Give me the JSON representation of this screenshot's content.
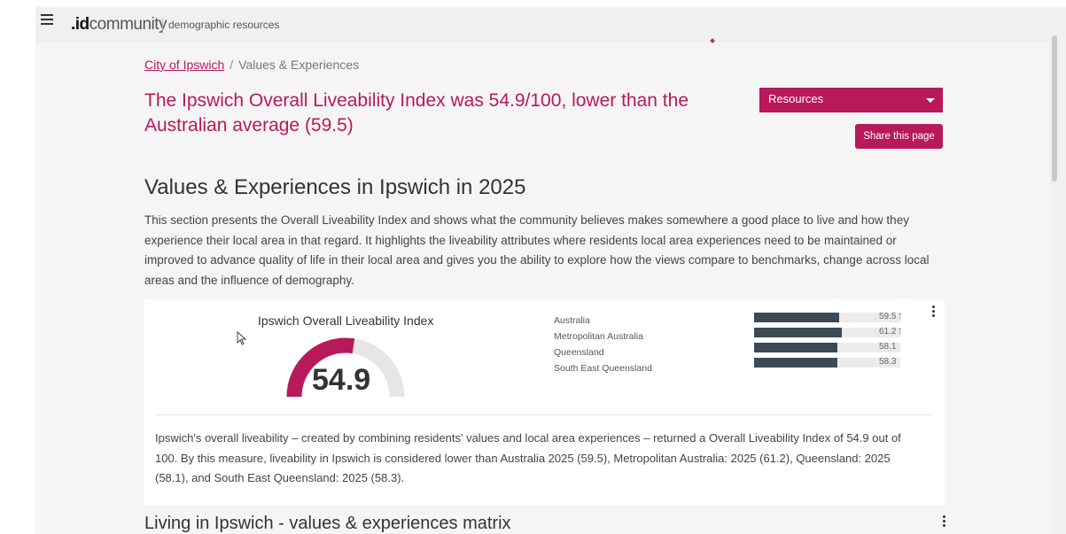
{
  "header": {
    "logo_bold": ".id",
    "logo_light": "community",
    "tagline": "demographic resources"
  },
  "breadcrumb": {
    "link": "City of Ipswich",
    "separator": "/",
    "current": "Values & Experiences"
  },
  "headline": "The Ipswich Overall Liveability Index was 54.9/100, lower than the Australian average (59.5)",
  "resources_label": "Resources",
  "share_label": "Share this page",
  "section": {
    "title": "Values & Experiences in Ipswich in 2025",
    "body": "This section presents the Overall Liveability Index and shows what the community believes makes somewhere a good place to live and how they experience their local area in that regard. It highlights the liveability attributes where residents local area experiences need to be maintained or improved to advance quality of life in their local area and gives you the ability to explore how the views compare to benchmarks, change across local areas and the influence of demography."
  },
  "index_card": {
    "gauge_title": "Ipswich Overall Liveability Index",
    "gauge_value": "54.9",
    "gauge_fraction": 0.549,
    "comparisons": [
      {
        "label": "Australia",
        "value": "59.5",
        "fraction": 0.595,
        "arrow": true
      },
      {
        "label": "Metropolitan Australia",
        "value": "61.2",
        "fraction": 0.612,
        "arrow": true
      },
      {
        "label": "Queensland",
        "value": "58.1",
        "fraction": 0.581,
        "arrow": false
      },
      {
        "label": "South East Queensland",
        "value": "58.3",
        "fraction": 0.583,
        "arrow": false
      }
    ],
    "summary": "Ipswich's overall liveability – created by combining residents' values and local area experiences – returned a Overall Liveability Index of 54.9 out of 100. By this measure, liveability in Ipswich is considered lower than Australia 2025 (59.5), Metropolitan Australia: 2025 (61.2), Queensland: 2025 (58.1), and South East Queensland: 2025 (58.3)."
  },
  "matrix_title": "Living in Ipswich - values & experiences matrix",
  "colors": {
    "brand": "#b8195a",
    "bar": "#3c4a56",
    "up_arrow": "#2aa86a"
  }
}
